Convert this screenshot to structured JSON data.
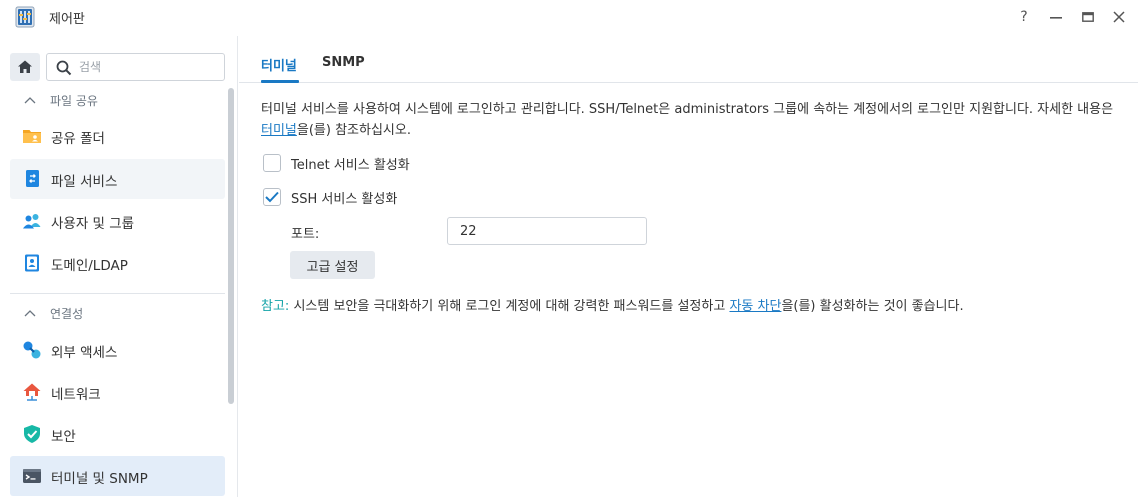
{
  "window": {
    "title": "제어판",
    "help_label": "?",
    "minimize_label": "—",
    "maximize_label": "▭",
    "close_label": "✕"
  },
  "sidebar": {
    "search_placeholder": "검색",
    "sections": [
      {
        "title": "파일 공유",
        "items": [
          {
            "label": "공유 폴더",
            "icon": "shared-folder-icon"
          },
          {
            "label": "파일 서비스",
            "icon": "file-services-icon"
          },
          {
            "label": "사용자 및 그룹",
            "icon": "users-icon"
          },
          {
            "label": "도메인/LDAP",
            "icon": "domain-ldap-icon"
          }
        ]
      },
      {
        "title": "연결성",
        "items": [
          {
            "label": "외부 액세스",
            "icon": "external-access-icon"
          },
          {
            "label": "네트워크",
            "icon": "network-icon"
          },
          {
            "label": "보안",
            "icon": "security-shield-icon"
          },
          {
            "label": "터미널 및 SNMP",
            "icon": "terminal-icon"
          }
        ]
      }
    ]
  },
  "main": {
    "tabs": [
      {
        "label": "터미널",
        "active": true
      },
      {
        "label": "SNMP",
        "active": false
      }
    ],
    "description": {
      "before_link": "터미널 서비스를 사용하여 시스템에 로그인하고 관리합니다. SSH/Telnet은 administrators 그룹에 속하는 계정에서의 로그인만 지원합니다. 자세한 내용은 ",
      "link": "터미널",
      "after_link": "을(를) 참조하십시오."
    },
    "telnet": {
      "label": "Telnet 서비스 활성화",
      "checked": false
    },
    "ssh": {
      "label": "SSH 서비스 활성화",
      "checked": true
    },
    "port": {
      "label": "포트:",
      "value": "22"
    },
    "advanced_button": "고급 설정",
    "note": {
      "label": "참고:",
      "before_link": " 시스템 보안을 극대화하기 위해 로그인 계정에 대해 강력한 패스워드를 설정하고 ",
      "link": "자동 차단",
      "after_link": "을(를) 활성화하는 것이 좋습니다."
    }
  },
  "colors": {
    "accent": "#1a79c4",
    "note_label": "#14a3a8",
    "selected_item": "#e3edf9"
  }
}
